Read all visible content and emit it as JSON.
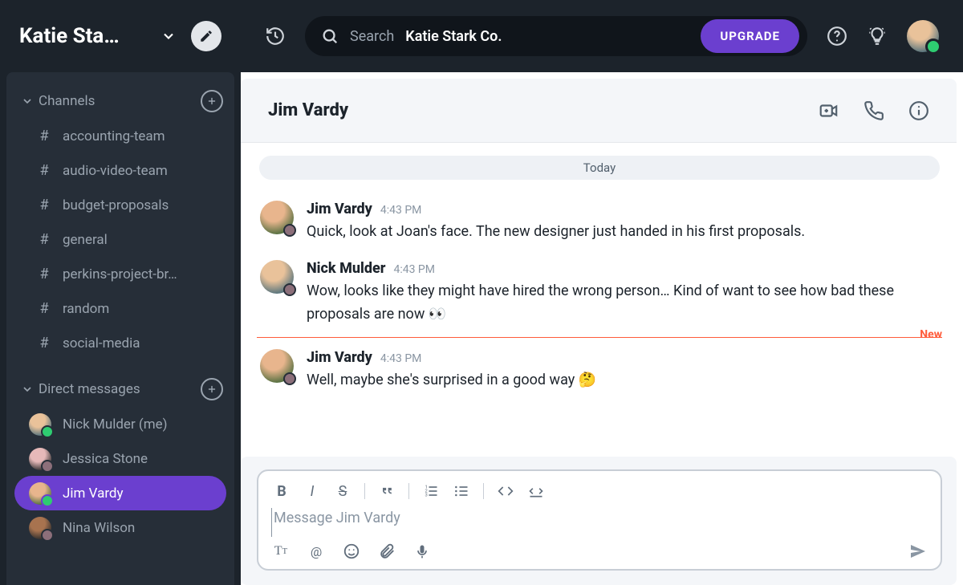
{
  "workspace": {
    "name_truncated": "Katie Sta…"
  },
  "topbar": {
    "search_label": "Search",
    "search_context": "Katie Stark Co.",
    "upgrade_label": "UPGRADE"
  },
  "sidebar": {
    "channels_label": "Channels",
    "dm_label": "Direct messages",
    "channels": [
      {
        "name": "accounting-team"
      },
      {
        "name": "audio-video-team"
      },
      {
        "name": "budget-proposals"
      },
      {
        "name": "general"
      },
      {
        "name": "perkins-project-br…"
      },
      {
        "name": "random"
      },
      {
        "name": "social-media"
      }
    ],
    "direct_messages": [
      {
        "name": "Nick Mulder (me)",
        "avatar_class": "av-nick",
        "online": true,
        "active": false
      },
      {
        "name": "Jessica Stone",
        "avatar_class": "av-jess",
        "online": false,
        "active": false
      },
      {
        "name": "Jim Vardy",
        "avatar_class": "av-jim",
        "online": true,
        "active": true
      },
      {
        "name": "Nina Wilson",
        "avatar_class": "av-nina",
        "online": false,
        "active": false
      }
    ]
  },
  "conversation": {
    "title": "Jim Vardy",
    "day_label": "Today",
    "new_label": "New",
    "composer_placeholder": "Message Jim Vardy",
    "messages": [
      {
        "author": "Jim Vardy",
        "time": "4:43 PM",
        "avatar_class": "av-jim",
        "text": "Quick, look at Joan's face. The new designer just handed in his first proposals."
      },
      {
        "author": "Nick Mulder",
        "time": "4:43 PM",
        "avatar_class": "av-nick",
        "text": "Wow, looks like they might have hired the wrong person… Kind of want to see how bad these proposals are now 👀"
      },
      {
        "author": "Jim Vardy",
        "time": "4:43 PM",
        "avatar_class": "av-jim",
        "text": "Well, maybe she's surprised in a good way 🤔"
      }
    ]
  },
  "colors": {
    "accent": "#6b3fcf",
    "sidebar_bg": "#1c232b",
    "new_divider": "#ff5b3a"
  }
}
